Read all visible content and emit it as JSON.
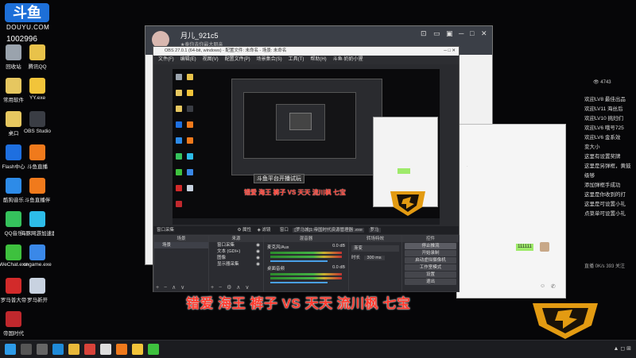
{
  "branding": {
    "logo_text": "斗鱼",
    "logo_sub": "DOUYU.COM",
    "room_id": "1002996"
  },
  "desktop_icons": [
    {
      "label": "回收站",
      "color": "#9aa3ad"
    },
    {
      "label": "腾讯QQ",
      "color": "#e8c24a"
    },
    {
      "label": "常用软件",
      "color": "#e6c760"
    },
    {
      "label": "YY.exe",
      "color": "#f2c43a"
    },
    {
      "label": "桌口",
      "color": "#e6c760"
    },
    {
      "label": "OBS Studio",
      "color": "#3a3d44"
    },
    {
      "label": "Flash中心",
      "color": "#1e6fe0"
    },
    {
      "label": "斗鱼直播",
      "color": "#f07a1c"
    },
    {
      "label": "酷狗音乐",
      "color": "#2d8be8"
    },
    {
      "label": "斗鱼直播伴",
      "color": "#f07a1c"
    },
    {
      "label": "QQ音乐",
      "color": "#35c25c"
    },
    {
      "label": "海豚网游加速器",
      "color": "#2dbce8"
    },
    {
      "label": "WeChat.exe",
      "color": "#3ec13e"
    },
    {
      "label": "cngame.exe",
      "color": "#3a88e8"
    },
    {
      "label": "罗马普大帝",
      "color": "#d22a2a"
    },
    {
      "label": "罗马新开",
      "color": "#c8d2e0"
    },
    {
      "label": "帝国时代",
      "color": "#c0282d"
    }
  ],
  "qq_window": {
    "name": "月儿_921c5",
    "subtitle": "★奉你去你最大朋亲",
    "controls": [
      "⊡",
      "▭",
      "▣",
      "─",
      "□",
      "✕"
    ]
  },
  "obs": {
    "title": "OBS 27.0.1 (64-bit, windows) - 配置文件: 未命名 - 场景: 未命名",
    "menu": [
      "文件(F)",
      "编辑(E)",
      "视图(V)",
      "配置文件(P)",
      "场景集合(S)",
      "工具(T)",
      "帮助(H)",
      "斗鱼·奶奶小猩"
    ],
    "source_bar": [
      "窗口采集",
      "属性",
      "滤镜",
      "窗口",
      "[罗马城]1:帝国时代资源管理器 .exe",
      "罗马"
    ],
    "panels": {
      "scenes": {
        "header": "场景",
        "items": [
          "场景"
        ]
      },
      "sources": {
        "header": "来源",
        "items": [
          "窗口采集",
          "文本 (GDI+)",
          "图像",
          "显示器采集"
        ]
      },
      "mixer": {
        "header": "混音器",
        "channels": [
          {
            "name": "麦克风/Aux",
            "db": "0.0 dB"
          },
          {
            "name": "桌面音频",
            "db": "0.0 dB"
          }
        ]
      },
      "transitions": {
        "header": "转场特效",
        "type": "渐变",
        "duration_label": "时长",
        "duration": "300 ms"
      },
      "controls": {
        "header": "控件",
        "buttons": [
          "停止推流",
          "开始录制",
          "启动虚拟摄像机",
          "工作室模式",
          "设置",
          "退出"
        ]
      }
    },
    "mini_caption": "错爱 海王 裤子 VS 天天 流川枫 七宝",
    "mini_banner": "斗鱼平台开播试玩"
  },
  "caption": "错爱 海王 裤子 VS 天天 流川枫 七宝",
  "wechat_window": {
    "bubble_text": "111111"
  },
  "chat": {
    "header_count": "4743",
    "messages": [
      {
        "level": "LV8",
        "text": "欢迎LV8 最佳出品"
      },
      {
        "level": "LV11",
        "text": "欢迎LV11 海丝后"
      },
      {
        "level": "LV10",
        "text": "欢迎LV10 挑妇们"
      },
      {
        "level": "LV6",
        "text": "欢迎LV6 哦号725"
      },
      {
        "level": "LV6",
        "text": "欢迎LV6 金系效"
      },
      {
        "level": "",
        "text": "变大小"
      },
      {
        "level": "",
        "text": "这里有设置奖牌"
      },
      {
        "level": "",
        "text": "这里是另弹框，黄鼓"
      },
      {
        "level": "",
        "text": "级够"
      },
      {
        "level": "",
        "text": "添加弹框手成功"
      },
      {
        "level": "",
        "text": "这里是你收到的打"
      },
      {
        "level": "",
        "text": "这里是可设置小礼"
      },
      {
        "level": "",
        "text": "点菜单可设置小礼"
      }
    ],
    "footer": "直播 0K/s 393 关注"
  },
  "taskbar": {
    "items": [
      {
        "name": "start",
        "color": "#2d9be8"
      },
      {
        "name": "search",
        "color": "#555"
      },
      {
        "name": "task-view",
        "color": "#666"
      },
      {
        "name": "edge",
        "color": "#1f8ad8"
      },
      {
        "name": "folder",
        "color": "#e8b83a"
      },
      {
        "name": "chrome",
        "color": "#d8433a"
      },
      {
        "name": "obs",
        "color": "#ddd"
      },
      {
        "name": "douyu",
        "color": "#f07a1c"
      },
      {
        "name": "yy",
        "color": "#f2c43a"
      },
      {
        "name": "wechat",
        "color": "#3ec13e"
      }
    ]
  }
}
